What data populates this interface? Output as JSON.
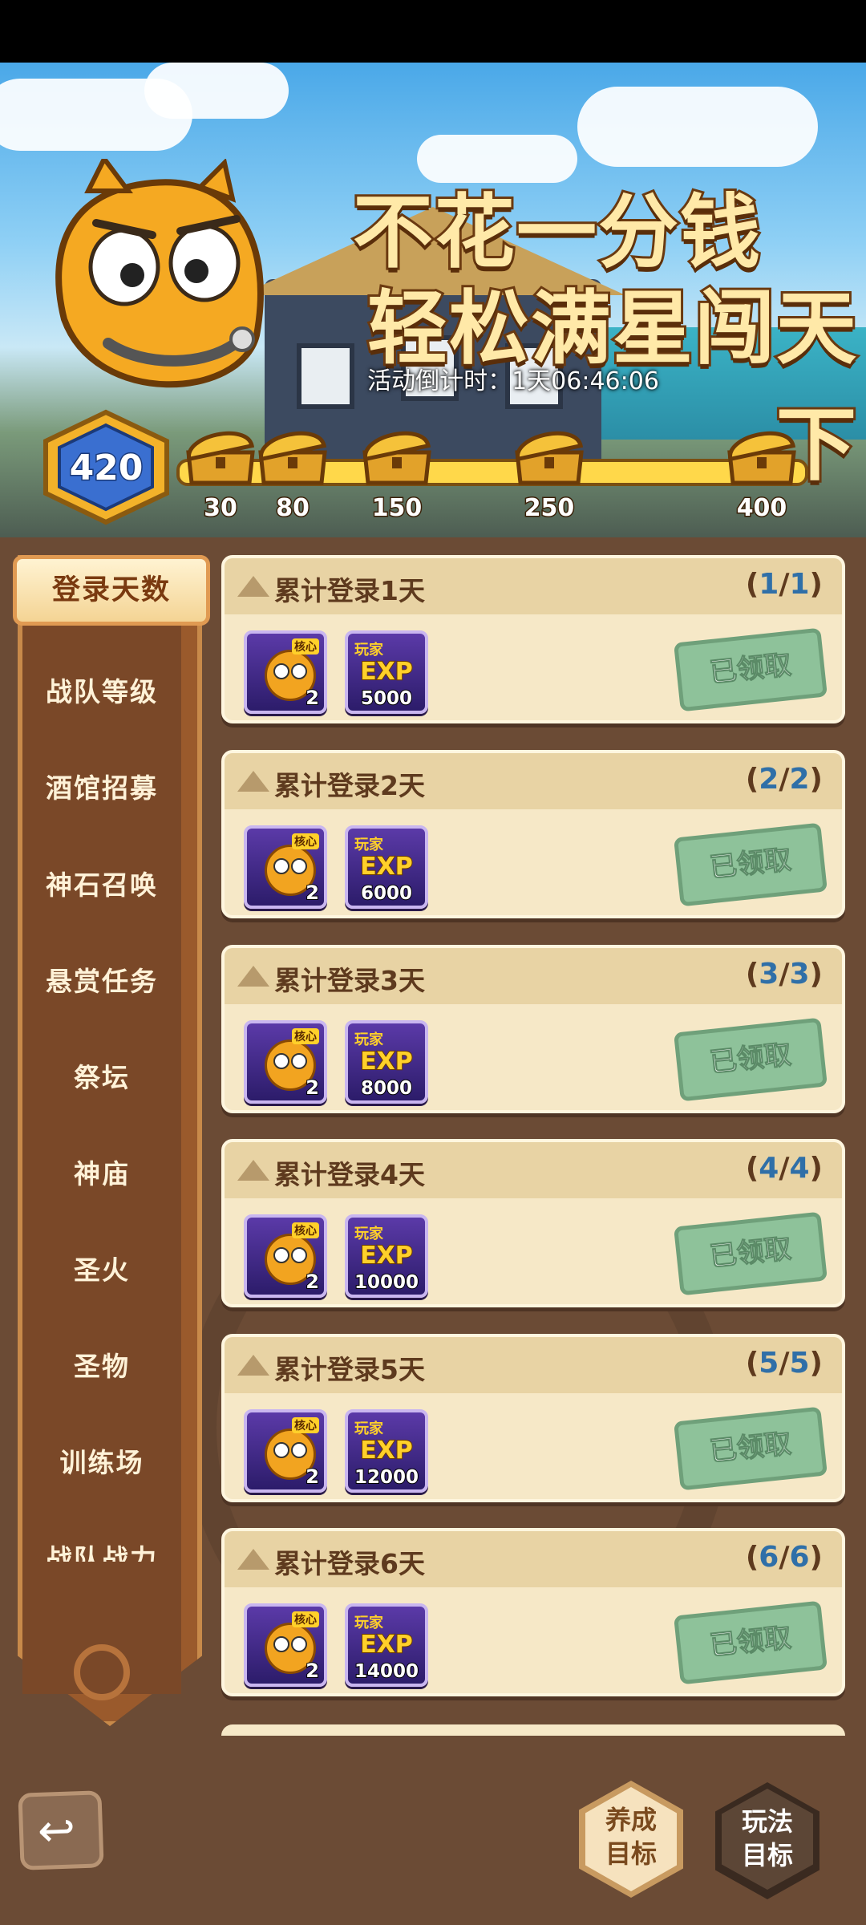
{
  "banner": {
    "headline_line1": "不花一分钱",
    "headline_line2": "轻松满星闯天下",
    "countdown": "活动倒计时：1天06:46:06",
    "score": "420",
    "milestones": [
      "30",
      "80",
      "150",
      "250",
      "400"
    ]
  },
  "sidebar": {
    "items": [
      "登录天数",
      "战队等级",
      "酒馆招募",
      "神石召唤",
      "悬赏任务",
      "祭坛",
      "神庙",
      "圣火",
      "圣物",
      "训练场",
      "战队战力"
    ]
  },
  "tasks": [
    {
      "title": "累计登录1天",
      "progress": "1",
      "total": "1",
      "qty": "2",
      "tag": "玩家",
      "exp_label": "EXP",
      "exp": "5000",
      "status": "已领取",
      "core": "核心"
    },
    {
      "title": "累计登录2天",
      "progress": "2",
      "total": "2",
      "qty": "2",
      "tag": "玩家",
      "exp_label": "EXP",
      "exp": "6000",
      "status": "已领取",
      "core": "核心"
    },
    {
      "title": "累计登录3天",
      "progress": "3",
      "total": "3",
      "qty": "2",
      "tag": "玩家",
      "exp_label": "EXP",
      "exp": "8000",
      "status": "已领取",
      "core": "核心"
    },
    {
      "title": "累计登录4天",
      "progress": "4",
      "total": "4",
      "qty": "2",
      "tag": "玩家",
      "exp_label": "EXP",
      "exp": "10000",
      "status": "已领取",
      "core": "核心"
    },
    {
      "title": "累计登录5天",
      "progress": "5",
      "total": "5",
      "qty": "2",
      "tag": "玩家",
      "exp_label": "EXP",
      "exp": "12000",
      "status": "已领取",
      "core": "核心"
    },
    {
      "title": "累计登录6天",
      "progress": "6",
      "total": "6",
      "qty": "2",
      "tag": "玩家",
      "exp_label": "EXP",
      "exp": "14000",
      "status": "已领取",
      "core": "核心"
    }
  ],
  "bottom": {
    "btn_growth_line1": "养成",
    "btn_growth_line2": "目标",
    "btn_play_line1": "玩法",
    "btn_play_line2": "目标"
  },
  "icons": {
    "back": "back-arrow-icon",
    "chest": "treasure-chest-icon",
    "score": "hexagon-badge-icon"
  },
  "colors": {
    "banner_track": "#ffd84a",
    "card_bg": "#f6e8c7",
    "claimed_stamp": "#8ec29a",
    "sidebar_bg": "#7a4828",
    "progress_number": "#2f6fa8"
  }
}
